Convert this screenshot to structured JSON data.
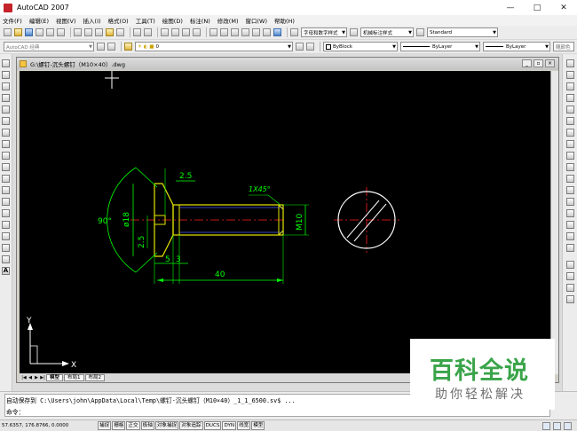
{
  "window": {
    "title": "AutoCAD 2007",
    "minimize_icon": "minimize-icon",
    "maximize_icon": "maximize-icon",
    "close_icon": "close-icon"
  },
  "menu": [
    {
      "label": "文件(F)"
    },
    {
      "label": "编辑(E)"
    },
    {
      "label": "视图(V)"
    },
    {
      "label": "插入(I)"
    },
    {
      "label": "格式(O)"
    },
    {
      "label": "工具(T)"
    },
    {
      "label": "绘图(D)"
    },
    {
      "label": "标注(N)"
    },
    {
      "label": "修改(M)"
    },
    {
      "label": "窗口(W)"
    },
    {
      "label": "帮助(H)"
    }
  ],
  "toolbar1": {
    "text_style": "字母和数字样式",
    "dim_style": "机械标注样式",
    "table_style": "Standard"
  },
  "toolbar2": {
    "workspace": "AutoCAD 经典",
    "layer": "0",
    "color": "ByBlock",
    "linetype": "ByLayer",
    "lineweight": "ByLayer",
    "plot_style": "随颜色"
  },
  "document": {
    "title": "G:\\螺钉-沉头螺钉（M10×40）.dwg"
  },
  "drawing": {
    "dim_angle": "90°",
    "dim_head_dia": "ø18",
    "dim_slot_depth": "2.5",
    "dim_head_height": "5",
    "dim_under_head": "3",
    "dim_slot_width": "2.5",
    "dim_length": "40",
    "dim_thread": "M10",
    "dim_chamfer": "1X45°",
    "ucs_y": "Y",
    "ucs_x": "X",
    "line_color": "#e6e600",
    "dim_color": "#00ff00",
    "center_color": "#ff2020"
  },
  "layout_tabs": [
    {
      "label": "模型",
      "active": true
    },
    {
      "label": "布局1",
      "active": false
    },
    {
      "label": "布局2",
      "active": false
    }
  ],
  "command": {
    "line1": "自动保存到 C:\\Users\\john\\AppData\\Local\\Temp\\螺钉-沉头螺钉（M10×40）_1_1_6500.sv$ ...",
    "line2": "命令："
  },
  "status": {
    "coords": "57.6357,  176.8766, 0.0000",
    "buttons": [
      {
        "label": "捕捉"
      },
      {
        "label": "栅格"
      },
      {
        "label": "正交"
      },
      {
        "label": "极轴"
      },
      {
        "label": "对象捕捉"
      },
      {
        "label": "对象追踪"
      },
      {
        "label": "DUCS"
      },
      {
        "label": "DYN"
      },
      {
        "label": "线宽"
      },
      {
        "label": "模型"
      }
    ]
  },
  "watermark": {
    "main": "百科全说",
    "sub": "助你轻松解决"
  }
}
